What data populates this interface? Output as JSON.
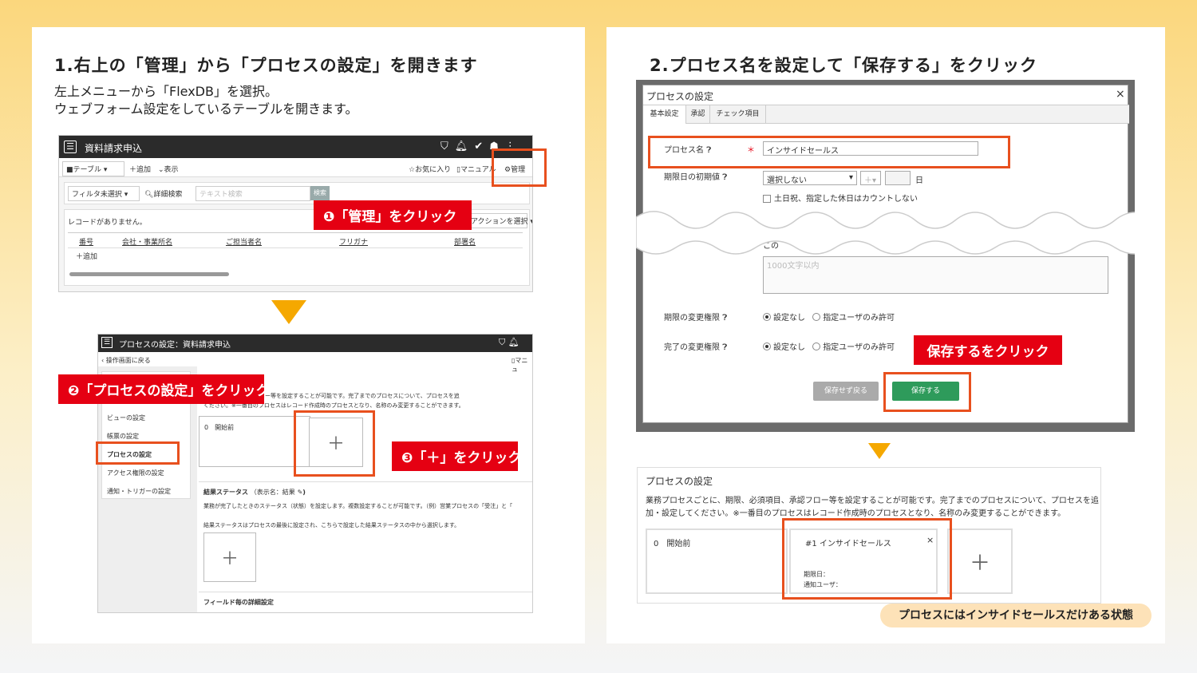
{
  "left": {
    "title": "1.右上の「管理」から「プロセスの設定」を開きます",
    "desc_lines": [
      "左上メニューから「FlexDB」を選択。",
      "ウェブフォーム設定をしているテーブルを開きます。"
    ],
    "shot1": {
      "app_title": "資料請求申込",
      "view_select": "■テーブル",
      "add": "＋追加",
      "view": "表示",
      "favorite": "お気に入り",
      "manual": "マニュアル",
      "manage": "管理",
      "filter_select": "フィルタ未選択",
      "detail_search": "詳細検索",
      "text_search_placeholder": "テキスト検索",
      "search_button": "検索",
      "no_records": "レコードがありません。",
      "action_select": "アクションを選択",
      "columns": [
        "番号",
        "会社・事業所名",
        "ご担当者名",
        "フリガナ",
        "部署名"
      ],
      "add_row": "＋追加"
    },
    "label1": "❶「管理」をクリック",
    "shot2": {
      "header_title": "プロセスの設定：資料請求申込",
      "back_link": "操作画面に戻る",
      "manual": "マニュ",
      "menu_items": [
        "ビューの設定",
        "帳票の設定",
        "プロセスの設定",
        "アクセス権限の設定",
        "通知・トリガーの設定"
      ],
      "desc_line1": "等、必須項目、承認フロー等を設定することが可能です。完了までのプロセスについて、プロセスを追",
      "desc_line2": "ください。※一番目のプロセスはレコード作成時のプロセスとなり、名称のみ変更することができます。",
      "initial_process": "0　開始前",
      "plus": "＋",
      "result_status_title": "結果ステータス",
      "result_status_sub": "（表示名：結果",
      "result_desc1": "業務が完了したときのステータス（状態）を設定します。複数設定することが可能です。（例）営業プロセスの「受注」と「",
      "result_desc2": "結果ステータスはプロセスの最後に設定され、こちらで設定した結果ステータスの中から選択します。",
      "field_detail": "フィールド毎の詳細設定"
    },
    "label2": "❷「プロセスの設定」をクリック",
    "label3": "❸「＋」をクリック"
  },
  "right": {
    "title": "2.プロセス名を設定して「保存する」をクリック",
    "dialog": {
      "title": "プロセスの設定",
      "close": "×",
      "tabs": [
        "基本設定",
        "承認",
        "チェック項目"
      ],
      "process_name_label": "プロセス名",
      "required_mark": "＊",
      "process_name_value": "インサイドセールス",
      "due_label": "期限日の初期値",
      "due_select": "選択しない",
      "due_offset": "＋",
      "day_unit": "日",
      "weekend_checkbox": "土日祝、指定した休日はカウントしない",
      "partial_text": "この",
      "textarea_placeholder": "1000文字以内",
      "due_perm_label": "期限の変更権限",
      "done_perm_label": "完了の変更権限",
      "opt_none": "設定なし",
      "opt_user": "指定ユーザのみ許可",
      "cancel_button": "保存せず戻る",
      "save_button": "保存する"
    },
    "label_save": "保存するをクリック",
    "result": {
      "title": "プロセスの設定",
      "desc1": "業務プロセスごとに、期限、必須項目、承認フロー等を設定することが可能です。完了までのプロセスについて、プロセスを追",
      "desc2": "加・設定してください。※一番目のプロセスはレコード作成時のプロセスとなり、名称のみ変更することができます。",
      "initial": "0　開始前",
      "card_title": "#1 インサイドセールス",
      "card_close": "×",
      "due": "期限日：",
      "notify": "通知ユーザ：",
      "plus": "＋"
    },
    "footnote": "プロセスにはインサイドセールスだけある状態"
  },
  "colors": {
    "accent_red": "#e50012",
    "box_orange": "#e8501e",
    "arrow": "#f5a800",
    "save_green": "#2e9b5b"
  }
}
